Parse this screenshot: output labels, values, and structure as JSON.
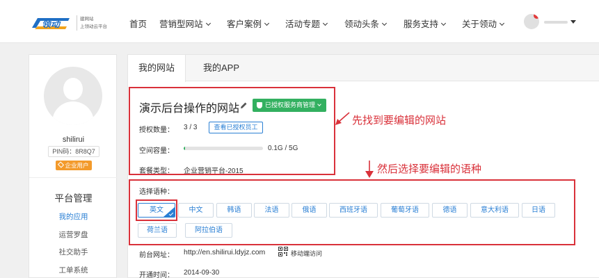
{
  "brand": {
    "logo_text": "领动",
    "tagline_1": "建网站",
    "tagline_2": "上领动云平台"
  },
  "nav": {
    "items": [
      {
        "label": "首页",
        "has_dropdown": false
      },
      {
        "label": "营销型网站",
        "has_dropdown": true
      },
      {
        "label": "客户案例",
        "has_dropdown": true
      },
      {
        "label": "活动专题",
        "has_dropdown": true
      },
      {
        "label": "领动头条",
        "has_dropdown": true
      },
      {
        "label": "服务支持",
        "has_dropdown": true
      },
      {
        "label": "关于领动",
        "has_dropdown": true
      }
    ]
  },
  "user": {
    "username": "shilirui",
    "pin": "PIN码：8R8Q7",
    "badge": "企业用户"
  },
  "sidebar": {
    "title": "平台管理",
    "items": [
      {
        "label": "我的应用",
        "active": true
      },
      {
        "label": "运营罗盘",
        "active": false
      },
      {
        "label": "社交助手",
        "active": false
      },
      {
        "label": "工单系统",
        "active": false
      }
    ]
  },
  "tabs": [
    {
      "label": "我的网站",
      "active": true
    },
    {
      "label": "我的APP",
      "active": false
    }
  ],
  "site": {
    "title": "演示后台操作的网站",
    "auth_label": "已授权服务商管理",
    "auth_count_label": "授权数量：",
    "auth_count": "3 / 3",
    "view_staff_button": "查看已授权员工",
    "space_label": "空间容量：",
    "space_value": "0.1G / 5G",
    "space_used_fraction": 0.02,
    "package_label": "套餐类型：",
    "package_value": "企业营销平台-2015",
    "front_label": "前台网址：",
    "front_url": "http://en.shilirui.ldyjz.com",
    "mobile_link": "移动端访问",
    "open_label": "开通时间：",
    "open_date": "2014-09-30"
  },
  "languages": {
    "label": "选择语种：",
    "items": [
      "英文",
      "中文",
      "韩语",
      "法语",
      "俄语",
      "西班牙语",
      "葡萄牙语",
      "德语",
      "意大利语",
      "日语",
      "荷兰语",
      "阿拉伯语"
    ],
    "selected": "英文"
  },
  "annotations": {
    "step1": "先找到要编辑的网站",
    "step2": "然后选择要编辑的语种"
  },
  "colors": {
    "accent_blue": "#2a7fd4",
    "green": "#33b060",
    "annotation_red": "#d9313a",
    "badge_orange": "#f39a2b"
  }
}
